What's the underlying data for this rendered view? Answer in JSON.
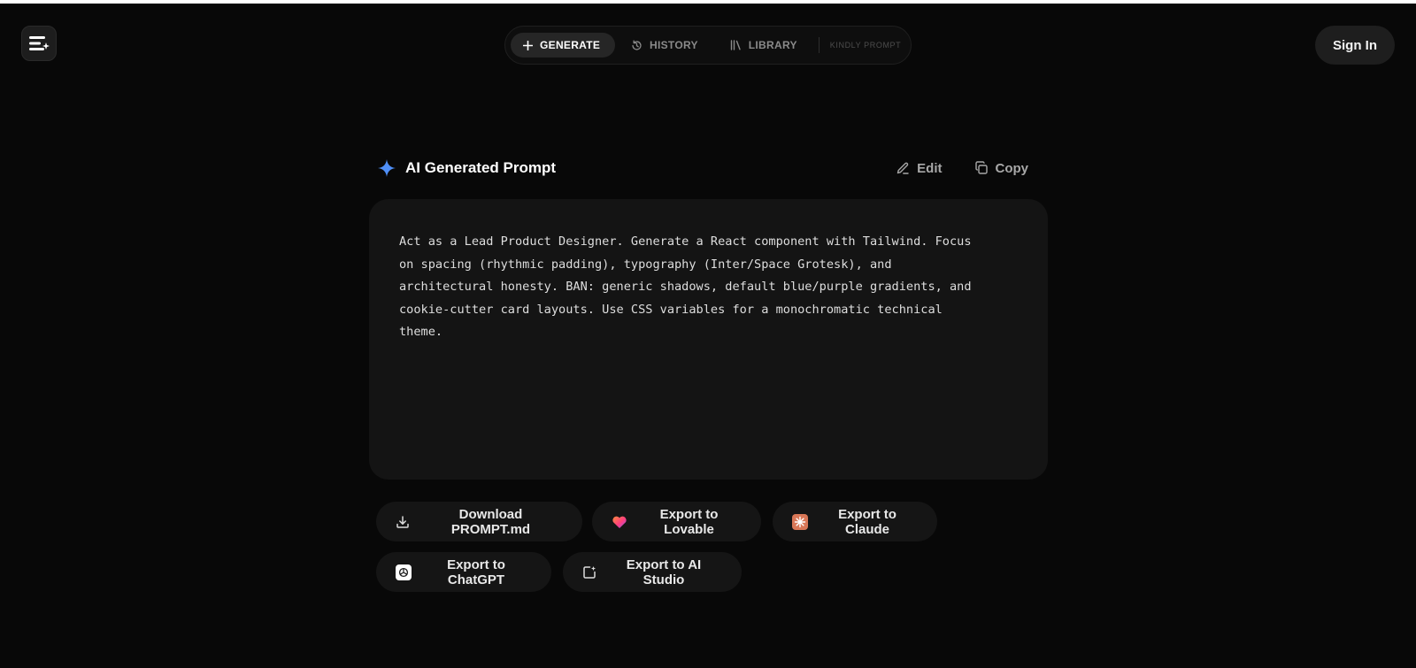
{
  "app": {
    "logo_icon": "menu-sparkle-icon"
  },
  "nav": {
    "items": [
      {
        "label": "GENERATE",
        "icon": "plus-icon",
        "active": true
      },
      {
        "label": "HISTORY",
        "icon": "history-icon",
        "active": false
      },
      {
        "label": "LIBRARY",
        "icon": "library-icon",
        "active": false
      }
    ],
    "brand": "KINDLY PROMPT"
  },
  "auth": {
    "signin_label": "Sign In"
  },
  "prompt": {
    "title": "AI Generated Prompt",
    "title_icon": "sparkle-icon",
    "edit_label": "Edit",
    "copy_label": "Copy",
    "text": "Act as a Lead Product Designer. Generate a React component with Tailwind. Focus\non spacing (rhythmic padding), typography (Inter/Space Grotesk), and\narchitectural honesty. BAN: generic shadows, default blue/purple gradients, and\ncookie-cutter card layouts. Use CSS variables for a monochromatic technical\ntheme."
  },
  "exports": [
    {
      "label": "Download PROMPT.md",
      "icon": "download-icon"
    },
    {
      "label": "Export to Lovable",
      "icon": "lovable-icon"
    },
    {
      "label": "Export to Claude",
      "icon": "claude-icon"
    },
    {
      "label": "Export to ChatGPT",
      "icon": "chatgpt-icon"
    },
    {
      "label": "Export to AI Studio",
      "icon": "ai-studio-icon"
    }
  ],
  "colors": {
    "background": "#080808",
    "card": "#141414",
    "accent_blue": "#4f8ff7",
    "claude_orange": "#d97757"
  }
}
